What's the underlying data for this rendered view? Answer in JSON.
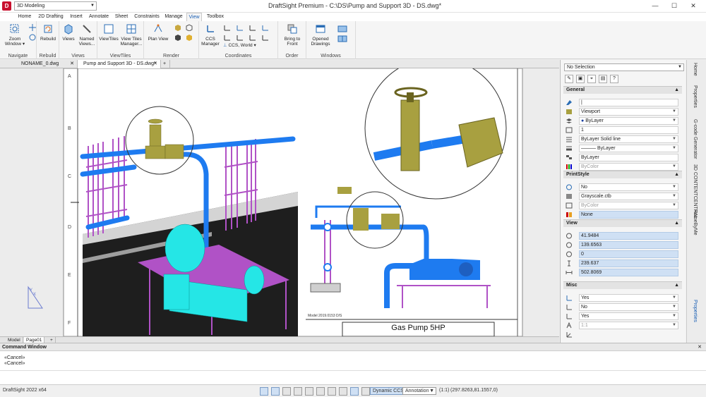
{
  "app": {
    "workspace": "3D Modeling",
    "title": "DraftSight Premium - C:\\DS\\Pump and Support 3D - DS.dwg*",
    "version": "DraftSight 2022 x64"
  },
  "ribbon_tabs": [
    "Home",
    "2D Drafting",
    "Insert",
    "Annotate",
    "Sheet",
    "Constraints",
    "Manage",
    "View",
    "Toolbox"
  ],
  "ribbon": {
    "zoom_window": "Zoom Window ▾",
    "rebuild": "Rebuild",
    "views": "Views",
    "named_views": "Named Views...",
    "viewtiles": "ViewTiles",
    "viewtiles_manager": "View Tiles Manager...",
    "plan_view": "Plan View",
    "ccs_manager": "CCS Manager",
    "ccs_world": "CCS, World",
    "bring_to_front": "Bring to Front",
    "opened_drawings": "Opened Drawings",
    "groups": [
      "Navigate",
      "Rebuild",
      "Views",
      "ViewTiles",
      "Render",
      "Coordinates",
      "Order",
      "Windows"
    ]
  },
  "doc_tabs": [
    "NONAME_0.dwg",
    "Pump and Support 3D - DS.dwg*"
  ],
  "sheet": {
    "row_labels": [
      "A",
      "B",
      "C",
      "D",
      "E",
      "F"
    ],
    "title_block": "Gas Pump 5HP",
    "small_text": "Model 2019.0153 D/S"
  },
  "layout_tabs": [
    "Model",
    "Page01"
  ],
  "properties": {
    "selection": "No Selection",
    "general_title": "General",
    "general": [
      "|",
      "Viewport",
      "ByLayer",
      "1",
      "ByLayer    Solid line",
      "ByLayer",
      "ByLayer",
      "ByColor"
    ],
    "printstyle_title": "PrintStyle",
    "printstyle": [
      "No",
      "Grayscale.ctb",
      "ByColor",
      "None"
    ],
    "view_title": "View",
    "view": [
      "41.9484",
      "139.6563",
      "0",
      "239.637",
      "502.8069"
    ],
    "misc_title": "Misc",
    "misc": [
      "Yes",
      "No",
      "Yes",
      "1:1"
    ]
  },
  "side_tabs": [
    "Home",
    "Properties",
    "G-code Generator",
    "3D CONTENTCENTRAL",
    "HomeByMe",
    "Properties"
  ],
  "command_window": {
    "title": "Command Window",
    "lines": [
      "«Cancel»",
      "«Cancel»"
    ]
  },
  "status": {
    "dynamic_ccs": "Dynamic CCS",
    "annotation": "Annotation",
    "scale": "(1:1)",
    "coords": "(297.8263,81.1557,0)"
  },
  "colors": {
    "pipe": "#1e7bf0",
    "pump": "#25e6e6",
    "support": "#b052c6",
    "valve": "#a8a040",
    "accent": "#1a5fb4"
  }
}
